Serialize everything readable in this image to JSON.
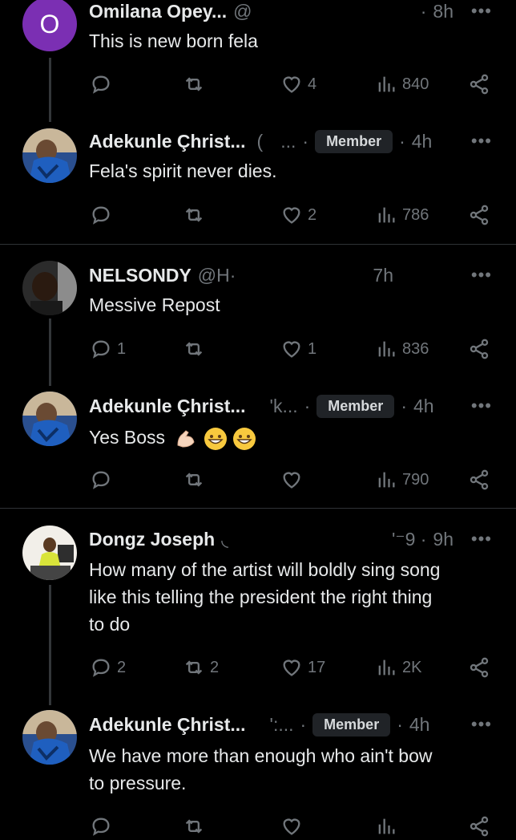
{
  "posts": [
    {
      "avatar_letter": "O",
      "name": "Omilana Opey...",
      "handle": "@",
      "time": "8h",
      "badge": "",
      "text": [
        "This is new born fela"
      ],
      "reply": "",
      "repost": "",
      "like": "4",
      "views": "840"
    },
    {
      "avatar_letter": "",
      "name": "Adekunle Çhrist...",
      "handle": "(",
      "handle2": "...",
      "time": "4h",
      "badge": "Member",
      "text": [
        "Fela's spirit never dies."
      ],
      "reply": "",
      "repost": "",
      "like": "2",
      "views": "786"
    },
    {
      "avatar_letter": "",
      "name": "NELSONDY",
      "handle": "@H·",
      "time": "7h",
      "badge": "",
      "text": [
        "Messive Repost"
      ],
      "reply": "1",
      "repost": "",
      "like": "1",
      "views": "836"
    },
    {
      "avatar_letter": "",
      "name": "Adekunle Çhrist...",
      "handle": "'k...",
      "time": "4h",
      "badge": "Member",
      "text": [
        "Yes Boss"
      ],
      "reply": "",
      "repost": "",
      "like": "",
      "views": "790"
    },
    {
      "avatar_letter": "",
      "name": "Dongz Joseph",
      "handle": "",
      "handle2": "'⁻9 ·",
      "time": "9h",
      "badge": "",
      "text": [
        "How many of the artist will boldly sing song",
        "like this telling the president the right thing",
        "to do"
      ],
      "reply": "2",
      "repost": "2",
      "like": "17",
      "views": "2K"
    },
    {
      "avatar_letter": "",
      "name": "Adekunle Çhrist...",
      "handle": "':...",
      "time": "4h",
      "badge": "Member",
      "text": [
        "We have more than enough who ain't bow",
        "to pressure."
      ]
    }
  ],
  "icons": {
    "more": "more-dots-icon",
    "reply": "reply-icon",
    "repost": "repost-icon",
    "like": "heart-icon",
    "views": "views-icon",
    "share": "share-icon"
  },
  "colors": {
    "bg": "#000000",
    "text": "#e7e9ea",
    "muted": "#71767b",
    "avatar_o": "#7b2fb3"
  }
}
